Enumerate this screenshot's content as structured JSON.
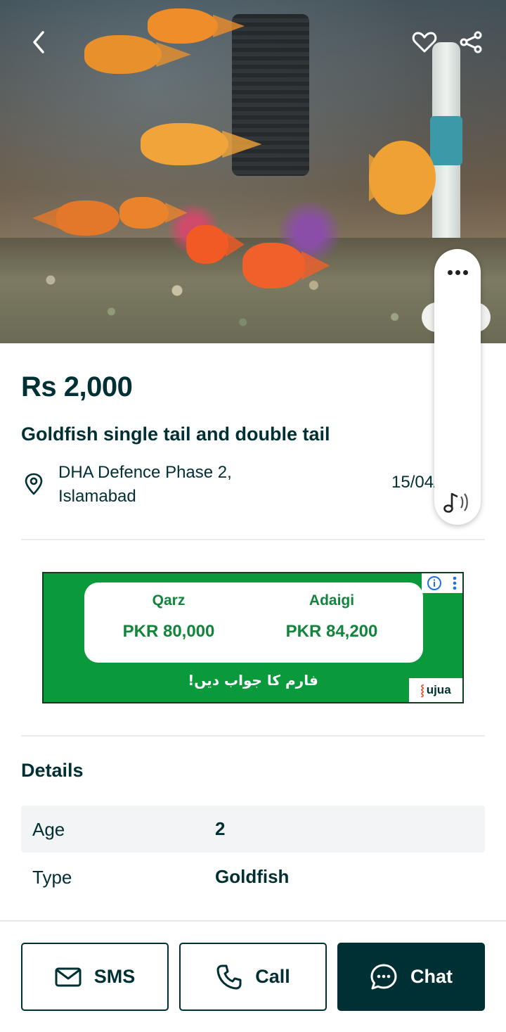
{
  "listing": {
    "price": "Rs 2,000",
    "title": "Goldfish single tail and double tail",
    "location_line1": "DHA Defence Phase 2,",
    "location_line2": "Islamabad",
    "date": "15/04/2025"
  },
  "hero": {
    "back_icon": "chevron-left-icon",
    "favorite_icon": "heart-outline-icon",
    "share_icon": "share-icon"
  },
  "ad": {
    "col1_label": "Qarz",
    "col1_value": "PKR 80,000",
    "col2_label": "Adaigi",
    "col2_value": "PKR 84,200",
    "urdu_text": "فارم کا جواب دیں!",
    "brand": "ujua",
    "colors": {
      "background": "#0a9a3b",
      "text": "#11853a"
    }
  },
  "details": {
    "heading": "Details",
    "rows": [
      {
        "key": "Age",
        "value": "2"
      },
      {
        "key": "Type",
        "value": "Goldfish"
      }
    ]
  },
  "actions": {
    "sms_label": "SMS",
    "call_label": "Call",
    "chat_label": "Chat"
  },
  "colors": {
    "primary": "#002f34",
    "divider": "#e8ecec",
    "row_shade": "#f2f4f5"
  }
}
